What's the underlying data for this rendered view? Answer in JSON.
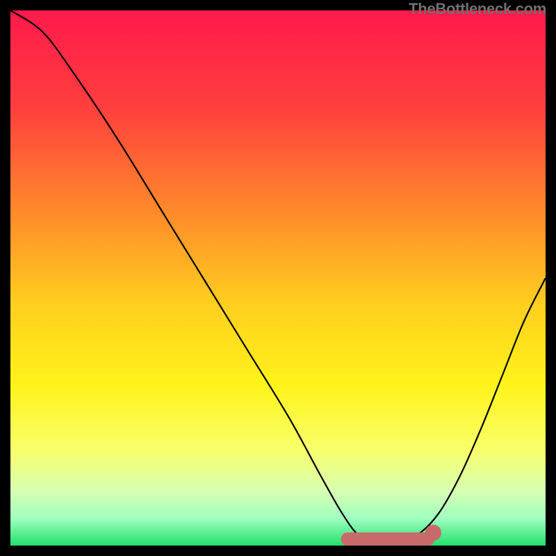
{
  "watermark": "TheBottleneck.com",
  "chart_data": {
    "type": "line",
    "title": "",
    "xlabel": "",
    "ylabel": "",
    "xlim": [
      0,
      100
    ],
    "ylim": [
      0,
      100
    ],
    "gradient_stops": [
      {
        "offset": 0,
        "color": "#ff1a4b"
      },
      {
        "offset": 18,
        "color": "#ff3e3e"
      },
      {
        "offset": 38,
        "color": "#ff8b2a"
      },
      {
        "offset": 55,
        "color": "#ffcf1f"
      },
      {
        "offset": 70,
        "color": "#fff31a"
      },
      {
        "offset": 82,
        "color": "#f8ff6a"
      },
      {
        "offset": 90,
        "color": "#d6ffb3"
      },
      {
        "offset": 95,
        "color": "#9effc0"
      },
      {
        "offset": 100,
        "color": "#22e06a"
      }
    ],
    "curve": {
      "description": "V-shaped bottleneck curve with flat minimum around x≈66–76; left branch starts at top-left corner, right branch rises to ~y=50 at right edge",
      "points": [
        {
          "x": 0,
          "y": 100
        },
        {
          "x": 6,
          "y": 96
        },
        {
          "x": 12,
          "y": 88
        },
        {
          "x": 20,
          "y": 76
        },
        {
          "x": 28,
          "y": 63
        },
        {
          "x": 36,
          "y": 50
        },
        {
          "x": 44,
          "y": 37
        },
        {
          "x": 52,
          "y": 24
        },
        {
          "x": 58,
          "y": 13
        },
        {
          "x": 62,
          "y": 6
        },
        {
          "x": 65,
          "y": 2
        },
        {
          "x": 68,
          "y": 1
        },
        {
          "x": 72,
          "y": 1
        },
        {
          "x": 76,
          "y": 2
        },
        {
          "x": 80,
          "y": 6
        },
        {
          "x": 84,
          "y": 13
        },
        {
          "x": 88,
          "y": 22
        },
        {
          "x": 92,
          "y": 32
        },
        {
          "x": 96,
          "y": 42
        },
        {
          "x": 100,
          "y": 50
        }
      ]
    },
    "flat_highlight": {
      "color": "#c86a6a",
      "x_start": 63,
      "x_end": 78,
      "y": 1.2,
      "thickness": 2.5,
      "end_dot_radius": 1.0
    }
  }
}
